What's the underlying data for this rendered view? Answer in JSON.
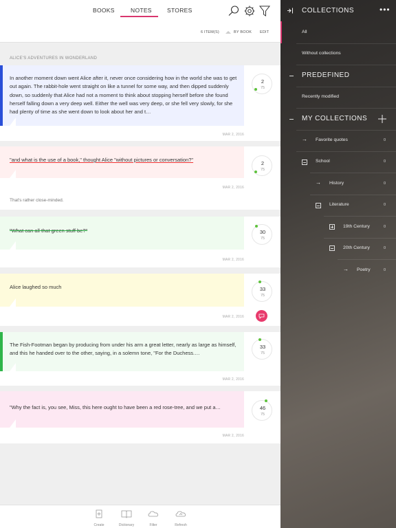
{
  "tabs": {
    "books": "BOOKS",
    "notes": "NOTES",
    "stores": "STORES"
  },
  "subbar": {
    "count": "6 ITEM(S)",
    "sort": "BY BOOK",
    "edit": "EDIT"
  },
  "book_title": "ALICE'S ADVENTURES IN WONDERLAND",
  "notes": [
    {
      "text": "In another moment down went Alice after it, never once considering how in the world she was to get out again. The rabbit-hole went straight on like a tunnel for some way, and then dipped suddenly down, so suddenly that Alice had not a moment to think about stopping herself before she found herself falling down a very deep well. Either the well was very deep, or she fell very slowly, for she had plenty of time as she went down to look about her and t…",
      "date": "MAR 2, 2016",
      "num": "2",
      "sub": "75",
      "color": "#eef1ff",
      "stripe": "#2a4fd8"
    },
    {
      "text": "\"and what is the use of a book,\" thought Alice \"without pictures or conversation?\"",
      "date": "MAR 2, 2016",
      "num": "2",
      "sub": "75",
      "color": "#fff0f0",
      "comment": "That's rather close-minded."
    },
    {
      "text": "\"What can all that green stuff be?\"",
      "date": "MAR 2, 2016",
      "num": "30",
      "sub": "75",
      "color": "#effbef"
    },
    {
      "text": "Alice laughed so much",
      "date": "MAR 2, 2016",
      "num": "33",
      "sub": "75",
      "color": "#fefbdc"
    },
    {
      "text": "The Fish-Footman began by producing from under his arm a great letter, nearly as large as himself, and this he handed over to the other, saying, in a solemn tone, \"For the Duchess.…",
      "date": "MAR 2, 2016",
      "num": "33",
      "sub": "75",
      "color": "#f1fbf2",
      "stripe": "#2fb54a"
    },
    {
      "text": "\"Why the fact is, you see, Miss, this here ought to have been a red rose-tree, and we put a…",
      "date": "MAR 2, 2016",
      "num": "46",
      "sub": "75",
      "color": "#fde8f3"
    }
  ],
  "bottom": {
    "create": "Create",
    "dictionary": "Dictionary",
    "filter": "Filter",
    "refresh": "Refresh"
  },
  "sidebar": {
    "collections_title": "COLLECTIONS",
    "all": "All",
    "without": "Without collections",
    "predefined_title": "PREDEFINED",
    "recent": "Recently modified",
    "my_title": "MY COLLECTIONS",
    "items": [
      {
        "label": "Favorite quotes",
        "count": "0"
      },
      {
        "label": "School",
        "count": "0"
      },
      {
        "label": "History",
        "count": "0"
      },
      {
        "label": "Literature",
        "count": "0"
      },
      {
        "label": "19th Century",
        "count": "0"
      },
      {
        "label": "20th Century",
        "count": "0"
      },
      {
        "label": "Poetry",
        "count": "0"
      }
    ]
  },
  "colors": {
    "accent": "#d8366e",
    "progress": "#5ec23d"
  },
  "icons": [
    "search-icon",
    "settings-icon",
    "filter-icon",
    "collapse-panel-icon",
    "more-icon",
    "add-icon",
    "create-icon",
    "dictionary-icon",
    "filter-cloud-icon",
    "refresh-cloud-icon",
    "comment-icon"
  ]
}
